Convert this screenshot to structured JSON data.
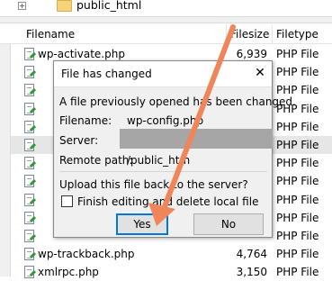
{
  "tree": {
    "folder_label": "public_html"
  },
  "list": {
    "headers": {
      "filename": "Filename",
      "filesize": "Filesize",
      "filetype": "Filetype"
    },
    "rows": [
      {
        "name": "wp-activate.php",
        "size": "6,939",
        "type": "PHP File"
      },
      {
        "name": "",
        "size": "",
        "type": "PHP File"
      },
      {
        "name": "",
        "size": "",
        "type": "PHP File"
      },
      {
        "name": "",
        "size": "",
        "type": "PHP File"
      },
      {
        "name": "",
        "size": "",
        "type": "PHP File"
      },
      {
        "name": "",
        "size": "",
        "type": "PHP File"
      },
      {
        "name": "",
        "size": "",
        "type": "PHP File"
      },
      {
        "name": "",
        "size": "",
        "type": "PHP File"
      },
      {
        "name": "",
        "size": "",
        "type": "PHP File"
      },
      {
        "name": "",
        "size": "",
        "type": "PHP File"
      },
      {
        "name": "",
        "size": "",
        "type": "PHP File"
      },
      {
        "name": "wp-trackback.php",
        "size": "4,764",
        "type": "PHP File"
      },
      {
        "name": "xmlrpc.php",
        "size": "3,150",
        "type": "PHP File"
      }
    ]
  },
  "dialog": {
    "title": "File has changed",
    "close_glyph": "✕",
    "message": "A file previously opened has been changed.",
    "filename_label": "Filename:",
    "filename_value": "wp-config.php",
    "server_label": "Server:",
    "remote_label": "Remote path:",
    "remote_value": "/public_htm",
    "question": "Upload this file back to the server?",
    "checkbox_label": "Finish editing and delete local file",
    "yes_label": "Yes",
    "no_label": "No"
  },
  "annotation": {
    "arrow_color": "#f0855a"
  },
  "colors": {
    "selected_row": "#e6e6e6",
    "default_button_border": "#0078d7"
  }
}
